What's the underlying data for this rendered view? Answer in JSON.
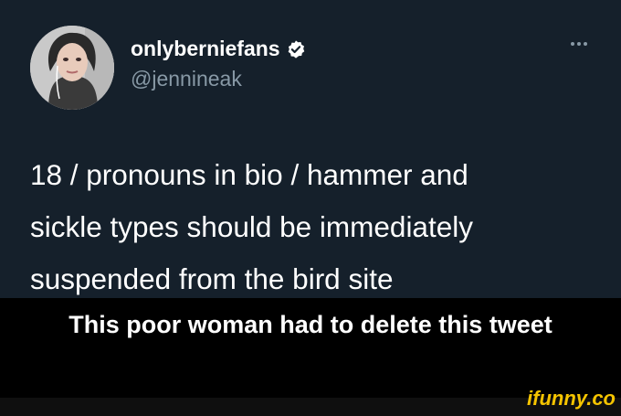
{
  "tweet": {
    "display_name": "onlyberniefans",
    "handle": "@jennineak",
    "verified_icon": "verified-badge-icon",
    "more_icon": "more-options-icon",
    "text_lines": [
      "18 / pronouns in bio / hammer and",
      "sickle types should be immediately",
      "suspended from the bird site"
    ]
  },
  "caption": "This poor woman had to delete this tweet",
  "watermark": "ifunny.co",
  "colors": {
    "tweet_background": "#15202b",
    "page_background": "#000000",
    "secondary_text": "#8899a6",
    "watermark": "#f5c400"
  }
}
